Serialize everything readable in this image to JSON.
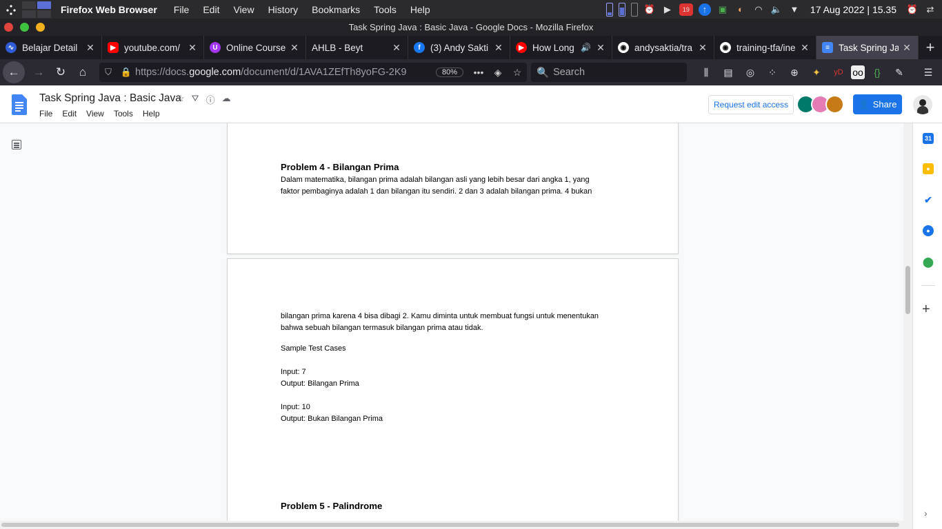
{
  "os": {
    "app_name": "Firefox Web Browser",
    "menu": [
      "File",
      "Edit",
      "View",
      "History",
      "Bookmarks",
      "Tools",
      "Help"
    ],
    "tray_badge": "19",
    "clock": "17 Aug 2022 | 15.35"
  },
  "window": {
    "title": "Task Spring Java : Basic Java - Google Docs - Mozilla Firefox"
  },
  "tabs": [
    {
      "label": "Belajar Detail",
      "favicon": "blue-circle-icon",
      "color": "#2f5bd6",
      "active": false
    },
    {
      "label": "youtube.com/",
      "favicon": "youtube-icon",
      "color": "#ff0000",
      "active": false
    },
    {
      "label": "Online Course",
      "favicon": "udemy-icon",
      "color": "#a435f0",
      "active": false
    },
    {
      "label": "AHLB - Beyt",
      "favicon": "",
      "color": "",
      "active": false
    },
    {
      "label": "(3) Andy Sakti",
      "favicon": "facebook-icon",
      "color": "#1877f2",
      "active": false
    },
    {
      "label": "How Long",
      "favicon": "youtube-red-icon",
      "color": "#ff0000",
      "active": false,
      "audio": true
    },
    {
      "label": "andysaktia/tra",
      "favicon": "github-icon",
      "color": "#fff",
      "active": false
    },
    {
      "label": "training-tfa/ine",
      "favicon": "github-icon",
      "color": "#fff",
      "active": false
    },
    {
      "label": "Task Spring Ja",
      "favicon": "docs-icon",
      "color": "#4285f4",
      "active": true
    }
  ],
  "navbar": {
    "url_prefix": "https://docs.",
    "url_domain": "google.com",
    "url_path": "/document/d/1AVA1ZEfTh8yoFG-2K9",
    "zoom": "80%",
    "search_placeholder": "Search"
  },
  "docs": {
    "title": "Task Spring Java : Basic Java",
    "menus": [
      "File",
      "Edit",
      "View",
      "Tools",
      "Help"
    ],
    "request_label": "Request edit access",
    "share_label": "Share"
  },
  "document": {
    "page1": {
      "heading": "Problem 4 - Bilangan Prima",
      "lines": [
        "Dalam matematika, bilangan prima adalah bilangan asli yang lebih besar dari angka 1, yang",
        "faktor pembaginya adalah 1 dan bilangan itu sendiri. 2 dan 3 adalah bilangan prima. 4 bukan"
      ]
    },
    "page2": {
      "lines": [
        "bilangan prima karena 4 bisa dibagi 2. Kamu diminta untuk membuat fungsi untuk menentukan",
        "bahwa sebuah bilangan termasuk bilangan prima atau tidak."
      ],
      "sample_title": "Sample Test Cases",
      "case1_input": "Input: 7",
      "case1_output": "Output: Bilangan Prima",
      "case2_input": "Input: 10",
      "case2_output": "Output: Bukan Bilangan Prima",
      "heading": "Problem 5 - Palindrome"
    }
  },
  "side_panel": [
    "calendar-icon",
    "keep-icon",
    "tasks-icon",
    "contacts-icon",
    "maps-icon"
  ]
}
